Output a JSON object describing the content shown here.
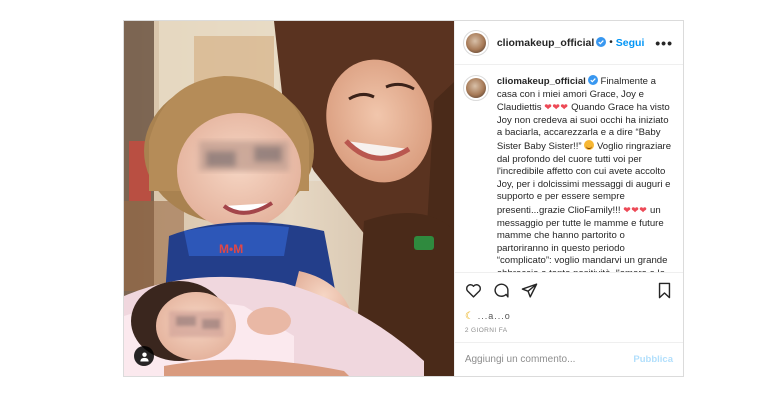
{
  "post": {
    "username": "cliomakeup_official",
    "follow_label": "Segui",
    "more_label": "•••",
    "caption": {
      "username": "cliomakeup_official",
      "part1": "Finalmente a casa con i miei amori Grace, Joy e Claudiettis",
      "hearts1": "❤❤❤",
      "part2": "Quando Grace ha visto Joy non credeva ai suoi occhi ha iniziato a baciarla, accarezzarla e a dire “Baby Sister Baby Sister!!”",
      "part3": "Voglio ringraziare dal profondo del cuore tutti voi per l'incredibile affetto con cui avete accolto Joy, per i dolcissimi messaggi di auguri e supporto e per essere sempre presenti...grazie ClioFamily!!!",
      "hearts2": "❤❤❤",
      "part4": "un messaggio per tutte le mamme e future mamme che hanno partorito o partoriranno in questo periodo “complicato”: voglio mandarvi un grande abbraccio e tanta positività, l'amore e la vita vincono sempre!"
    },
    "likes_fragment": "...a...o",
    "timestamp": "2 GIORNI FA",
    "comment_placeholder": "Aggiungi un commento...",
    "publish_label": "Pubblica"
  },
  "icons": {
    "like": "heart-outline-icon",
    "comment": "speech-bubble-icon",
    "share": "paper-plane-icon",
    "save": "bookmark-icon",
    "verified": "verified-badge-icon",
    "user_tag": "user-tag-icon"
  },
  "colors": {
    "link_blue": "#0095f6",
    "verified_blue": "#3897f0",
    "publish_disabled": "#b2dffc",
    "heart_red": "#ed4956",
    "muted": "#8e8e8e",
    "border": "#dbdbdb"
  }
}
